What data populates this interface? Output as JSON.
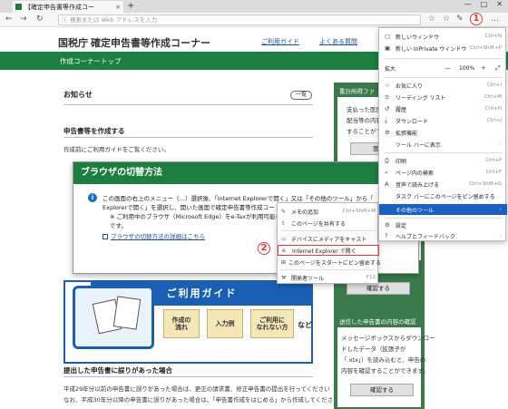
{
  "browser": {
    "tab_title": "【確定申告書等作成コー",
    "tab_close": "×",
    "new_tab": "+",
    "win_min": "—",
    "win_max": "□",
    "win_close": "✕",
    "address_placeholder": "検索または Web アドレスを入力",
    "marker1": "1",
    "marker2": "2"
  },
  "site": {
    "title": "国税庁 確定申告書等作成コーナー",
    "link_usage": "ご利用ガイド",
    "link_faq": "よくある質問",
    "nav_label": "作成コーナートップ",
    "notice": "お知らせ",
    "list_button": "一覧",
    "section_create": "申告書等を作成する",
    "create_text": "作成前にご利用ガイドをご覧ください。",
    "section_error": "提出した申告書に誤りがあった場合",
    "error_text1": "平成29年分以前の申告書に誤りがあった場合は、更正の請求書、修正申告書の提出を行ってください",
    "error_text2": "なお、平成30年分以降の申告書に誤りがあった場合は、「申告書作成をはじめる」から作成してください"
  },
  "right_panel": {
    "head1": "重計所得ファ",
    "text1": "支払った医療費",
    "text2": "配当等の内容等",
    "text3": "することができま",
    "btn1": "医療費",
    "btn2": "じる",
    "btn3": "確認する",
    "head2": "送信した申告書の内容の確認",
    "text4": "メッセージボックスからダウンロー",
    "text5": "ドしたデータ（拡張子が",
    "text6": "「.xtx」）を読み込むと、申告の",
    "text7": "内容を確認することができます。",
    "btn4": "確認する"
  },
  "guide": {
    "title": "ご利用ガイド",
    "item1": "作成の\n流れ",
    "item2": "入力例",
    "item3": "ご利用に\nなれない方",
    "nado": "など"
  },
  "dialog": {
    "title": "ブラウザの切替方法",
    "info": "i",
    "line1": "この画面の右上のメニュー（…）選択後、「Internet Explorerで開く」又は「その他のツール」から「",
    "line2": "Explorerで開く」を選択し、開いた画面で確定申告書等作成コー",
    "line3": "※ ご利用中のブラウザ（Microsoft Edge）をe-Taxが利用可能なブラ",
    "line4": "です。",
    "link": "ブラウザの切替方法の詳細はこちら"
  },
  "submenu": {
    "items": [
      {
        "icon": "✎",
        "label": "メモの追加",
        "shortcut": "Ctrl+Shift+M"
      },
      {
        "icon": "⇪",
        "label": "このページを共有する",
        "shortcut": ""
      },
      {
        "icon": "▭",
        "label": "デバイスにメディアをキャスト",
        "shortcut": ""
      },
      {
        "icon": "e",
        "label": "Internet Explorer で開く",
        "shortcut": ""
      },
      {
        "icon": "⊞",
        "label": "このページをスタートにピン留めする",
        "shortcut": ""
      },
      {
        "icon": "⚒",
        "label": "開発者ツール",
        "shortcut": "F12"
      }
    ]
  },
  "mainmenu": {
    "items": [
      {
        "icon": "▢",
        "label": "新しいウィンドウ",
        "shortcut": "Ctrl+N"
      },
      {
        "icon": "▣",
        "label": "新しい InPrivate ウィンドウ",
        "shortcut": "Ctrl+Shift+P"
      },
      {
        "icon": "☆",
        "label": "お気に入り",
        "shortcut": "Ctrl+I"
      },
      {
        "icon": "≡",
        "label": "リーディング リスト",
        "shortcut": "Ctrl+M"
      },
      {
        "icon": "↺",
        "label": "履歴",
        "shortcut": "Ctrl+H"
      },
      {
        "icon": "⤓",
        "label": "ダウンロード",
        "shortcut": "Ctrl+J"
      },
      {
        "icon": "⚙",
        "label": "拡張機能",
        "shortcut": ""
      },
      {
        "icon": "",
        "label": "ツール バーに表示",
        "shortcut": "›"
      },
      {
        "icon": "⎙",
        "label": "印刷",
        "shortcut": "Ctrl+P"
      },
      {
        "icon": "⌕",
        "label": "ページ内の検索",
        "shortcut": "Ctrl+F"
      },
      {
        "icon": "A",
        "label": "音声で読み上げる",
        "shortcut": "Ctrl+Shift+G"
      },
      {
        "icon": "",
        "label": "タスク バーにこのページをピン留めする",
        "shortcut": ""
      },
      {
        "icon": "",
        "label": "その他のツール",
        "shortcut": "›"
      },
      {
        "icon": "⚙",
        "label": "設定",
        "shortcut": ""
      },
      {
        "icon": "?",
        "label": "ヘルプとフィードバック",
        "shortcut": "›"
      }
    ],
    "zoom_label": "拡大",
    "zoom_minus": "—",
    "zoom_value": "100%",
    "zoom_plus": "+",
    "zoom_full": "⤢"
  },
  "colors": {
    "accent_green": "#1d7f3f",
    "menu_highlight": "#1a5fc4",
    "annotation_red": "#e53935"
  }
}
